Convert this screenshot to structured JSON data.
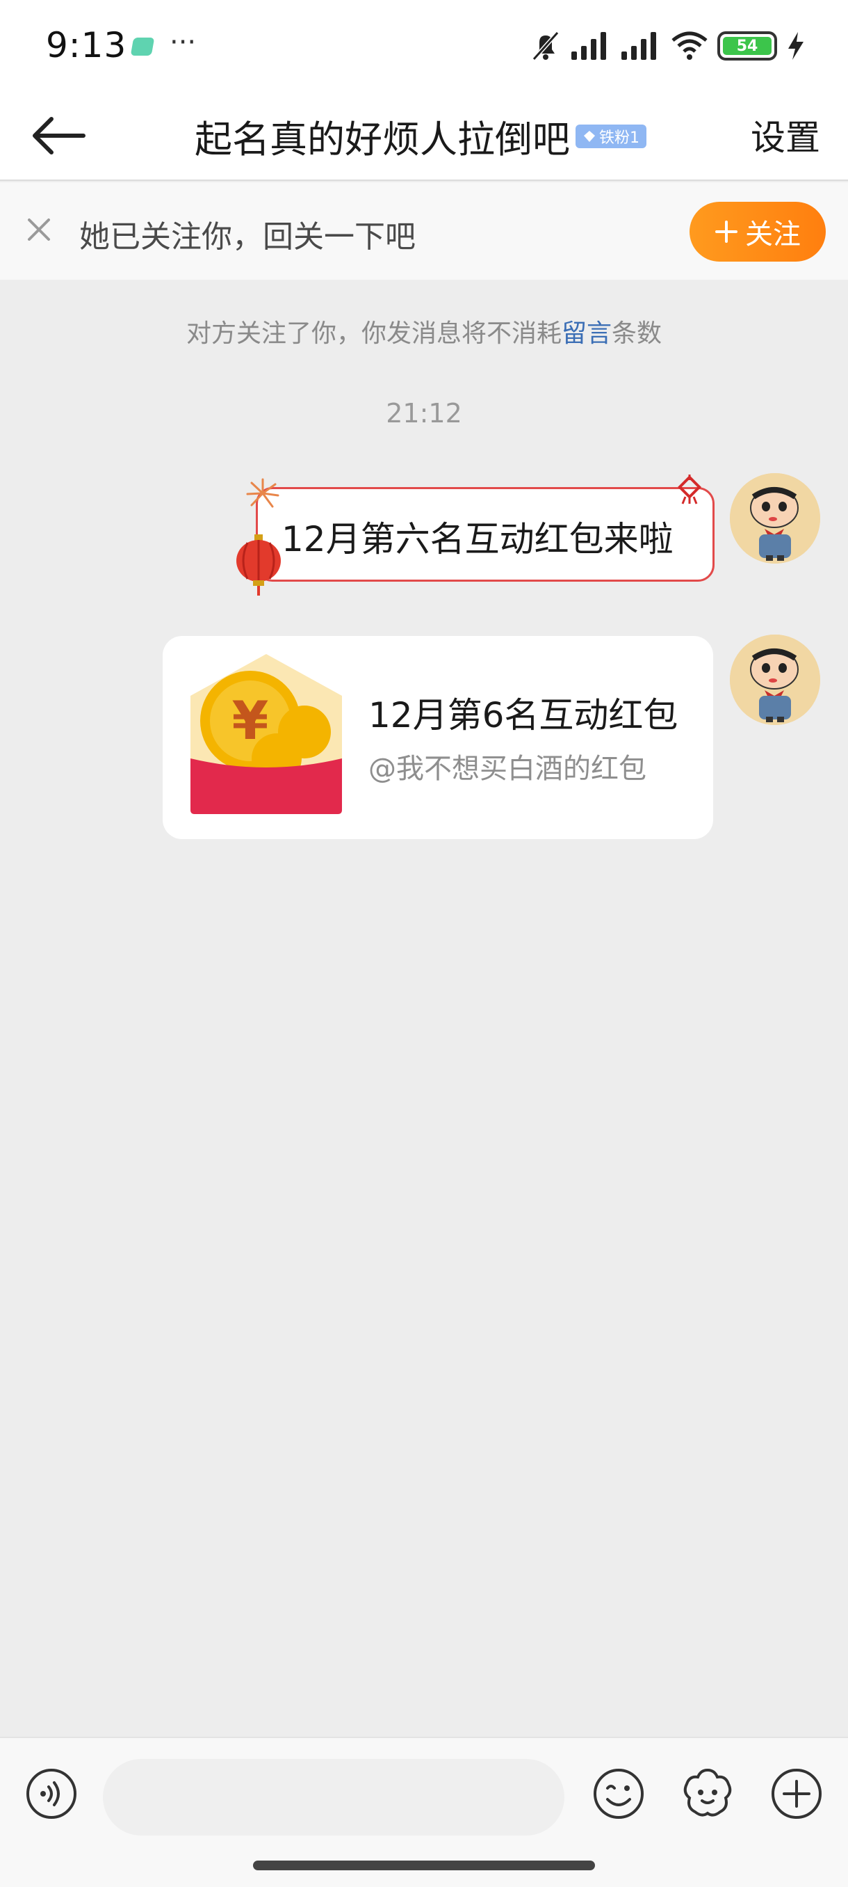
{
  "status_bar": {
    "time": "9:13",
    "more": "···",
    "battery": "54",
    "icons": [
      "app-notification-icon",
      "mute-icon",
      "signal-icon",
      "signal-icon",
      "wifi-icon",
      "battery-icon",
      "charging-icon"
    ]
  },
  "header": {
    "title": "起名真的好烦人拉倒吧",
    "badge": "铁粉1",
    "settings_label": "设置"
  },
  "follow_bar": {
    "message": "她已关注你，回关一下吧",
    "button_label": "关注",
    "button_color": "#ff8a17"
  },
  "chat": {
    "notice_prefix": "对方关注了你，你发消息将不消耗",
    "notice_link": "留言",
    "notice_suffix": "条数",
    "timestamp": "21:12",
    "messages": [
      {
        "type": "festive-text",
        "text": "12月第六名互动红包来啦"
      },
      {
        "type": "red-packet",
        "title": "12月第6名互动红包",
        "subtitle": "@我不想买白酒的红包"
      }
    ]
  },
  "input_bar": {
    "placeholder": "",
    "icons": [
      "voice-icon",
      "emoji-icon",
      "sticker-icon",
      "plus-icon"
    ]
  },
  "colors": {
    "accent": "#ff8a17",
    "link": "#3b6eb5",
    "festive_border": "#e24a4a",
    "background": "#ededed"
  }
}
